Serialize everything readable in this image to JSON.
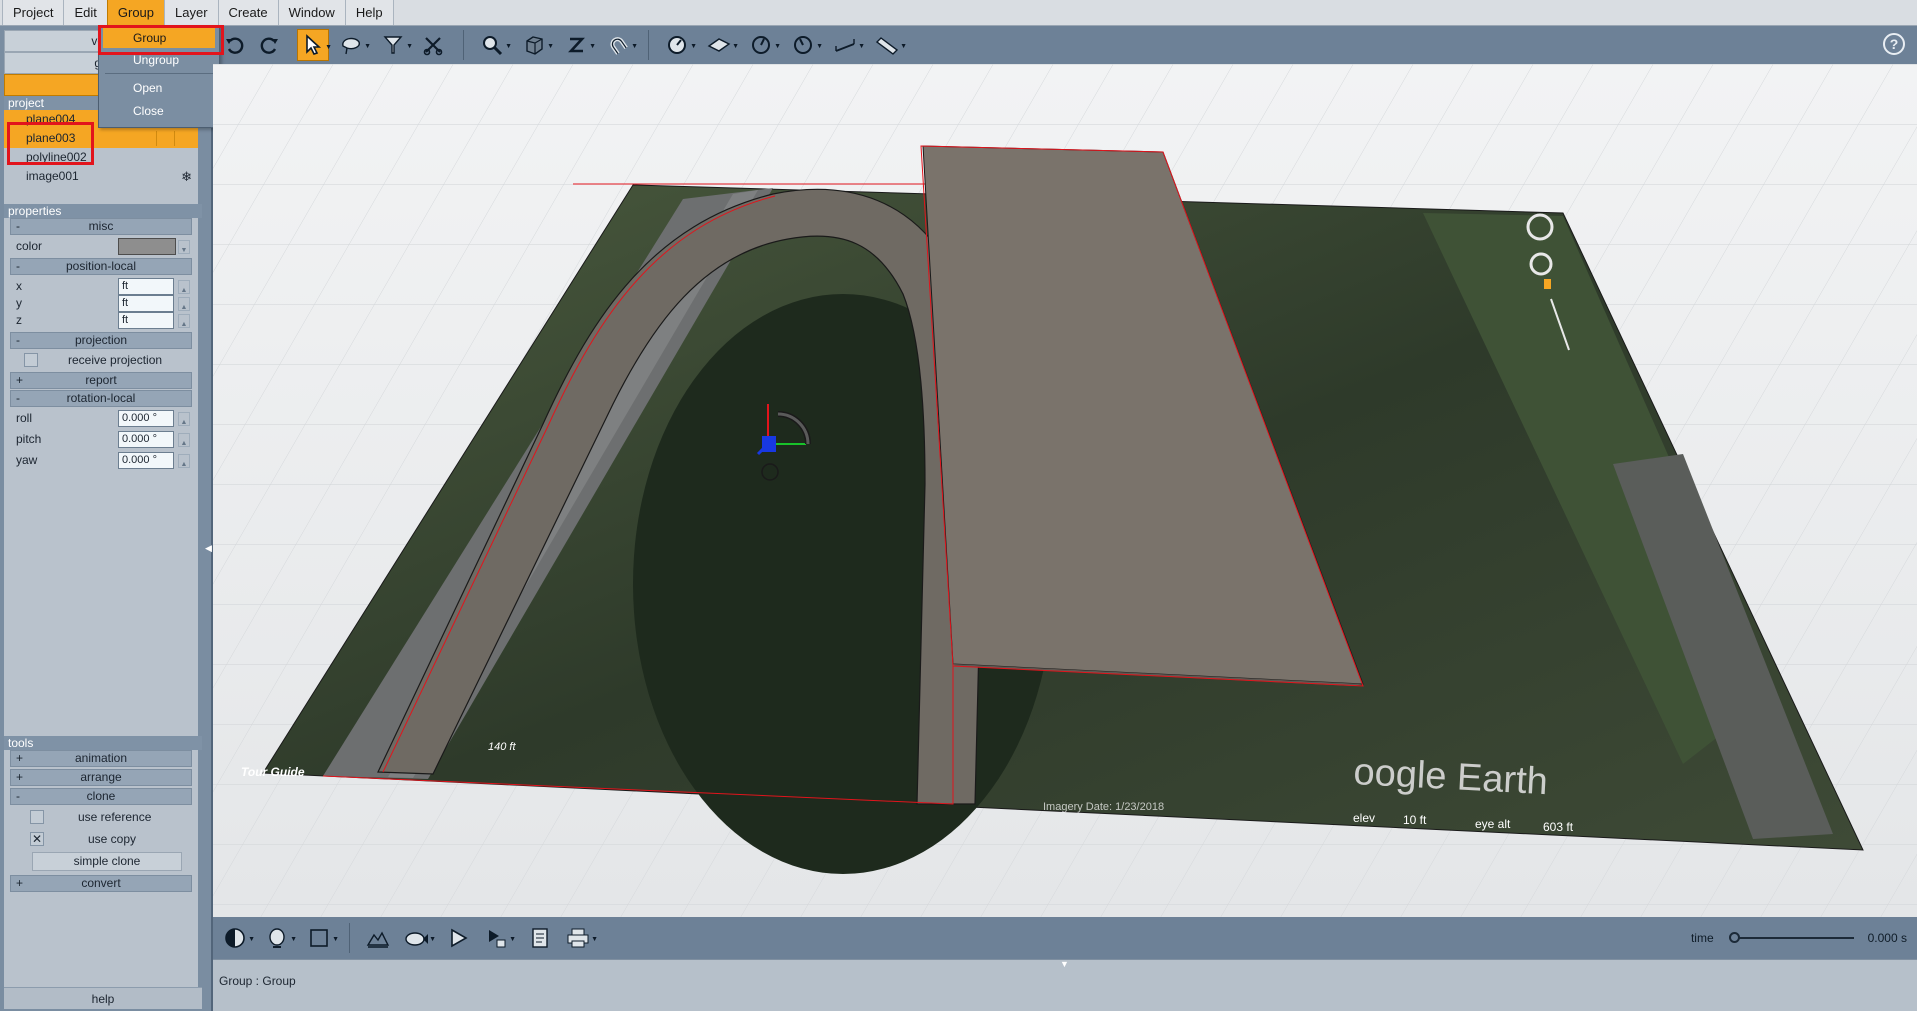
{
  "menubar": {
    "items": [
      "Project",
      "Edit",
      "Group",
      "Layer",
      "Create",
      "Window",
      "Help"
    ],
    "active": "Group"
  },
  "group_menu": {
    "items": [
      "Group",
      "Ungroup",
      "Open",
      "Close"
    ],
    "highlighted": "Group"
  },
  "left_panel": {
    "top_buttons": [
      "veh",
      "ga",
      "e"
    ],
    "project": {
      "header": "project",
      "items": [
        {
          "name": "plane004",
          "selected": true
        },
        {
          "name": "plane003",
          "selected": true
        },
        {
          "name": "polyline002",
          "selected": false
        },
        {
          "name": "image001",
          "selected": false
        }
      ]
    },
    "properties": {
      "header": "properties",
      "misc": {
        "title": "misc",
        "sign": "-",
        "color_label": "color",
        "color": "#8e8e8e"
      },
      "position": {
        "title": "position-local",
        "sign": "-",
        "x_label": "x",
        "y_label": "y",
        "z_label": "z",
        "x": "ft",
        "y": "ft",
        "z": "ft"
      },
      "projection": {
        "title": "projection",
        "sign": "-",
        "receive_label": "receive projection"
      },
      "report": {
        "title": "report",
        "sign": "+"
      },
      "rotation": {
        "title": "rotation-local",
        "sign": "-",
        "roll_label": "roll",
        "pitch_label": "pitch",
        "yaw_label": "yaw",
        "roll": "0.000 °",
        "pitch": "0.000 °",
        "yaw": "0.000 °"
      }
    },
    "tools": {
      "header": "tools",
      "animation": {
        "title": "animation",
        "sign": "+"
      },
      "arrange": {
        "title": "arrange",
        "sign": "+"
      },
      "clone": {
        "title": "clone",
        "sign": "-",
        "use_reference": "use reference",
        "use_copy": "use copy",
        "use_copy_checked": "✕",
        "simple_clone": "simple clone"
      },
      "convert": {
        "title": "convert",
        "sign": "+"
      }
    },
    "help": "help"
  },
  "toolbar": {
    "icons": [
      "redo-icon",
      "select-arrow-icon",
      "lasso-select-icon",
      "filter-icon",
      "scissors-icon",
      "zoom-icon",
      "box-icon",
      "z-axis-icon",
      "magnet-icon",
      "speedometer-icon",
      "plane-icon",
      "gauge-icon",
      "gauge-alt-icon",
      "measure-icon",
      "ruler-icon"
    ],
    "help": "?"
  },
  "viewport": {
    "scale_label": "140 ft",
    "tour_guide": "Tour Guide",
    "watermark": "oogle Earth",
    "elev_label": "elev",
    "elev_value": "10 ft",
    "eye_alt_label": "eye alt",
    "eye_alt_value": "603 ft",
    "imagery_text": "Imagery Date: 1/23/2018"
  },
  "bottombar": {
    "time_label": "time",
    "time_value": "0.000 s"
  },
  "status": {
    "text": "Group : Group"
  }
}
